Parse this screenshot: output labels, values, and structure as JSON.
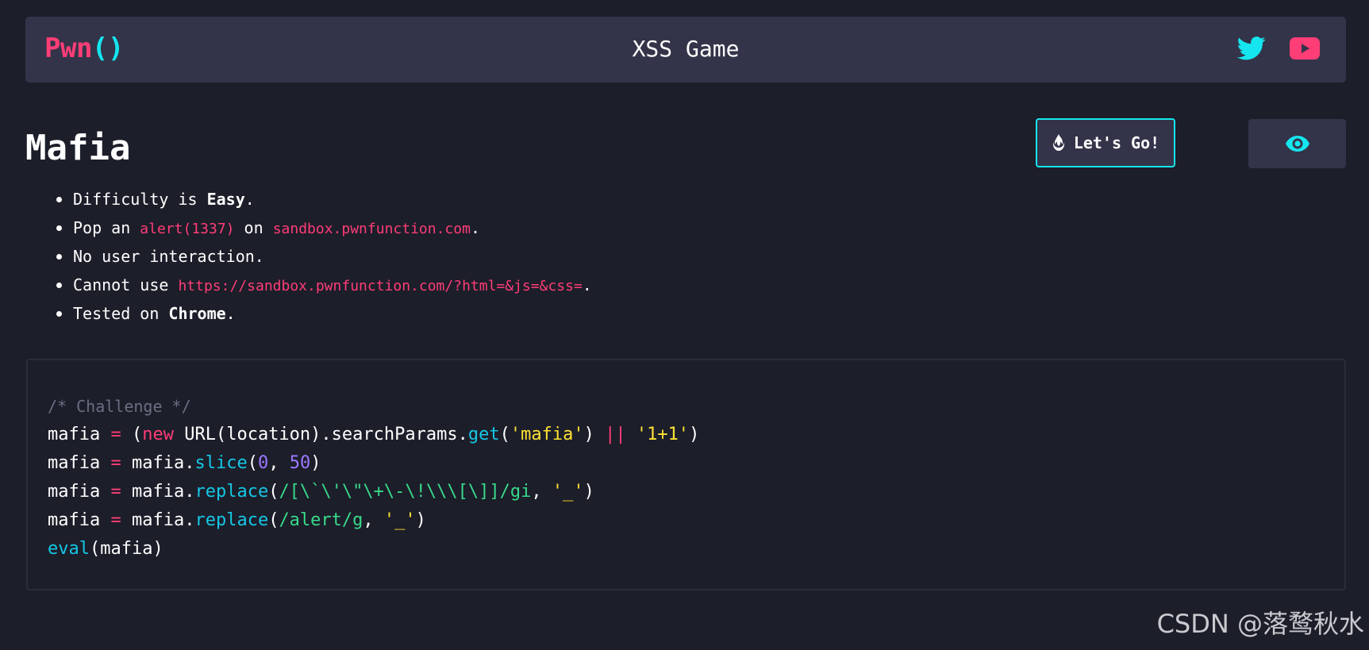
{
  "header": {
    "brand_prefix": "Pwn",
    "brand_suffix": "()",
    "title": "XSS Game",
    "social": [
      {
        "icon": "twitter-icon",
        "color": "#15e5ee"
      },
      {
        "icon": "youtube-icon",
        "color": "#ff3d76"
      }
    ]
  },
  "challenge": {
    "title": "Mafia",
    "go_button_icon": "fire-icon",
    "go_button_label": "Let's Go!",
    "view_button_icon": "eye-icon"
  },
  "rules": [
    {
      "before": "Difficulty is ",
      "strong": "Easy",
      "after": "."
    },
    {
      "before": "Pop an ",
      "code1": "alert(1337)",
      "middle": " on ",
      "code2": "sandbox.pwnfunction.com",
      "after": "."
    },
    {
      "text": "No user interaction."
    },
    {
      "before": "Cannot use ",
      "code": "https://sandbox.pwnfunction.com/?html=&js=&css=",
      "after": "."
    },
    {
      "before": "Tested on ",
      "strong": "Chrome",
      "after": "."
    }
  ],
  "code": {
    "comment": "/* Challenge */",
    "lines": [
      {
        "var": "mafia",
        "eq": " = ",
        "open": "(",
        "kw": "new",
        "ctor": " URL(location).searchParams",
        "dot": ".",
        "fn": "get",
        "p1": "(",
        "s1": "'mafia'",
        "p2": ") ",
        "op": "||",
        "sp": " ",
        "s2": "'1+1'",
        "p3": ")"
      },
      {
        "var": "mafia",
        "eq": " = ",
        "obj": "mafia",
        "dot": ".",
        "fn": "slice",
        "p1": "(",
        "n1": "0",
        "comma": ", ",
        "n2": "50",
        "p2": ")"
      },
      {
        "var": "mafia",
        "eq": " = ",
        "obj": "mafia",
        "dot": ".",
        "fn": "replace",
        "p1": "(",
        "re": "/[\\`\\'\\\"\\+\\-\\!\\\\\\[\\]]/gi",
        "comma": ", ",
        "s1": "'_'",
        "p2": ")"
      },
      {
        "var": "mafia",
        "eq": " = ",
        "obj": "mafia",
        "dot": ".",
        "fn": "replace",
        "p1": "(",
        "re": "/alert/g",
        "comma": ", ",
        "s1": "'_'",
        "p2": ")"
      },
      {
        "fn": "eval",
        "args": "(mafia)"
      }
    ]
  },
  "watermark": "CSDN @落鹜秋水",
  "colors": {
    "background": "#1c1e2a",
    "panel": "#333449",
    "accent_pink": "#ff3d76",
    "accent_cyan": "#15e5ee",
    "string_yellow": "#ffe234",
    "regex_green": "#39d98a",
    "number_purple": "#9d79ff",
    "comment_gray": "#6b6e82"
  }
}
